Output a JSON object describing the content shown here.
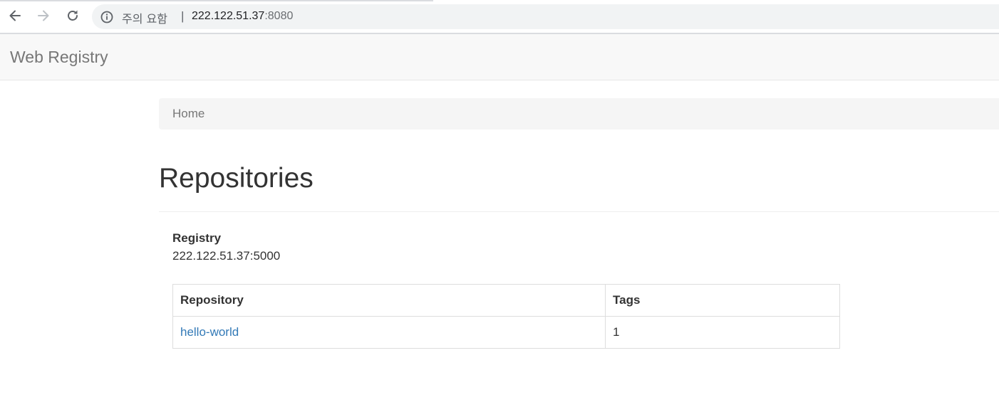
{
  "browser": {
    "security_label": "주의 요함",
    "separator": "|",
    "url_host": "222.122.51.37",
    "url_port": ":8080"
  },
  "navbar": {
    "brand": "Web Registry"
  },
  "breadcrumb": {
    "home": "Home"
  },
  "main": {
    "title": "Repositories",
    "registry_label": "Registry",
    "registry_value": "222.122.51.37:5000",
    "table": {
      "headers": [
        "Repository",
        "Tags"
      ],
      "rows": [
        {
          "repository": "hello-world",
          "tags": "1"
        }
      ]
    }
  },
  "colors": {
    "link": "#337ab7",
    "navbar_bg": "#f8f8f8",
    "breadcrumb_bg": "#f5f5f5"
  },
  "icons": {
    "back": "arrow-left-icon",
    "forward": "arrow-right-icon",
    "reload": "reload-icon",
    "info": "info-icon"
  }
}
